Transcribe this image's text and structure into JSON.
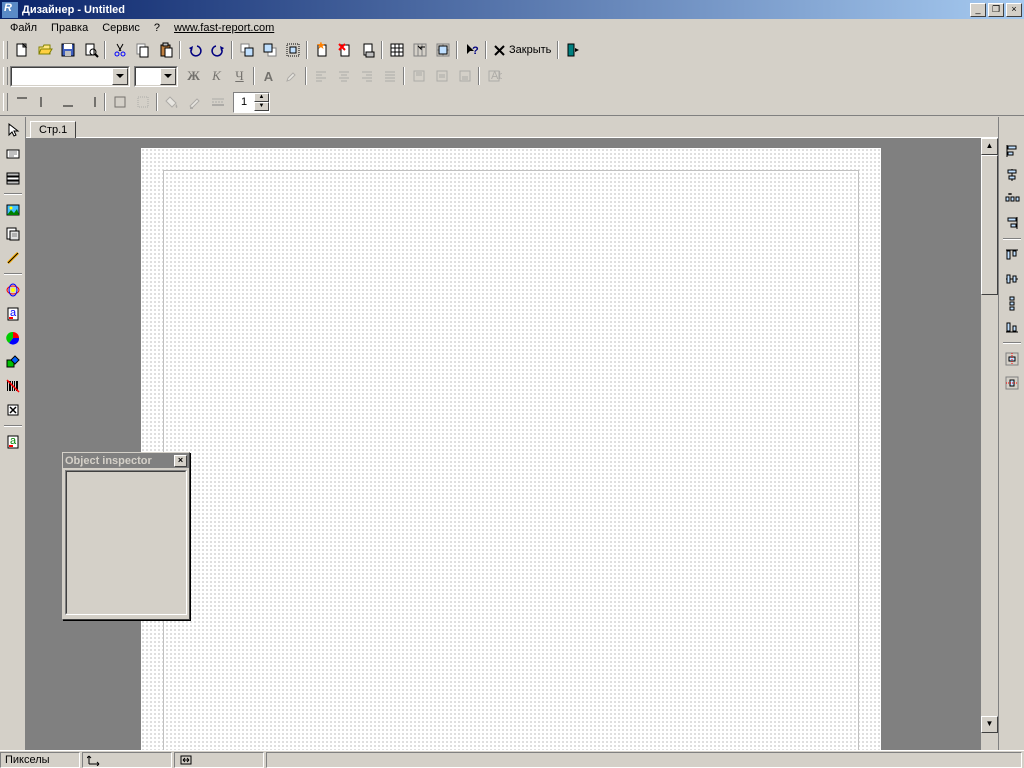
{
  "window": {
    "title": "Дизайнер - Untitled"
  },
  "menu": {
    "file": "Файл",
    "edit": "Правка",
    "service": "Сервис",
    "help": "?",
    "url": "www.fast-report.com"
  },
  "toolbar": {
    "close_label": "Закрыть"
  },
  "spinner": {
    "value": "1"
  },
  "tabs": {
    "page1": "Стр.1"
  },
  "inspector": {
    "title": "Object inspector"
  },
  "status": {
    "units": "Пикселы"
  }
}
